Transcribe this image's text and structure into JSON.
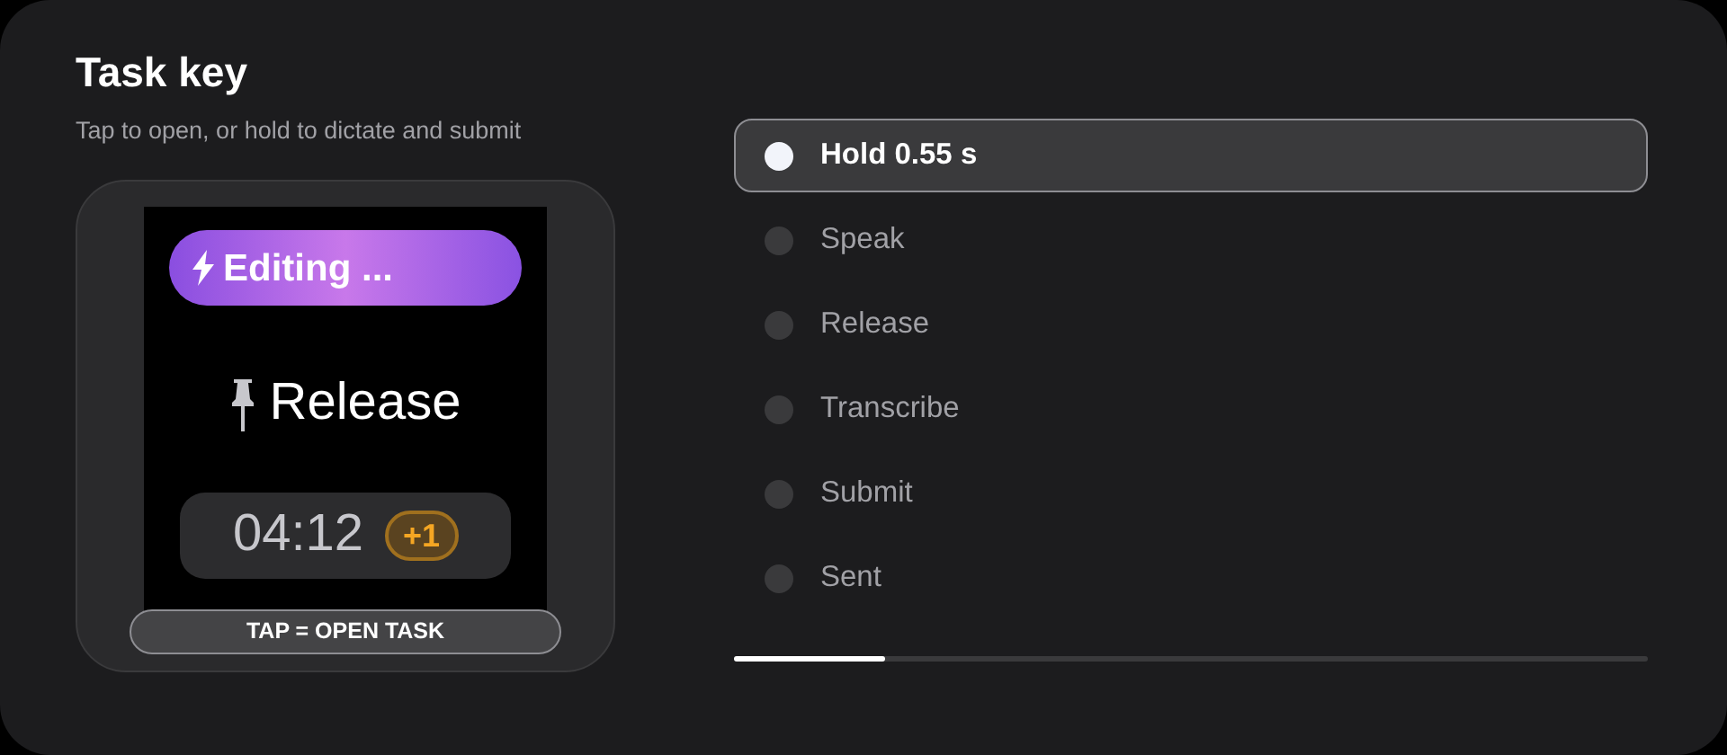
{
  "header": {
    "title": "Task key",
    "subtitle": "Tap to open, or hold to dictate and submit"
  },
  "device": {
    "status": "Editing ...",
    "label": "Release",
    "timer": "04:12",
    "badge": "+1",
    "caption": "TAP = OPEN TASK"
  },
  "steps": [
    {
      "label": "Hold 0.55 s",
      "selected": true
    },
    {
      "label": "Speak",
      "selected": false
    },
    {
      "label": "Release",
      "selected": false
    },
    {
      "label": "Transcribe",
      "selected": false
    },
    {
      "label": "Submit",
      "selected": false
    },
    {
      "label": "Sent",
      "selected": false
    }
  ],
  "progress": {
    "level": 0.165
  }
}
